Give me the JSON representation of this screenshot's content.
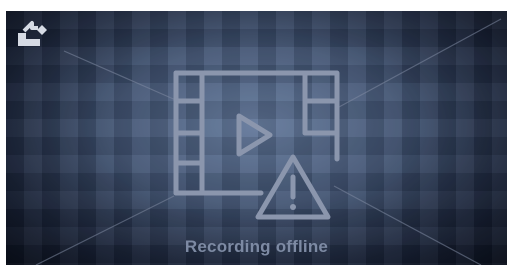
{
  "player": {
    "status_text": "Recording offline",
    "icons": {
      "corner": "share-icon",
      "center": "video-film-icon",
      "play": "play-icon",
      "warning": "warning-triangle-icon"
    },
    "colors": {
      "icon_stroke": "#8b96ad",
      "corner_icon": "#d6dbe4",
      "text": "#7d8aa3",
      "background_center": "#61779a",
      "background_edge": "#0f1729"
    }
  }
}
